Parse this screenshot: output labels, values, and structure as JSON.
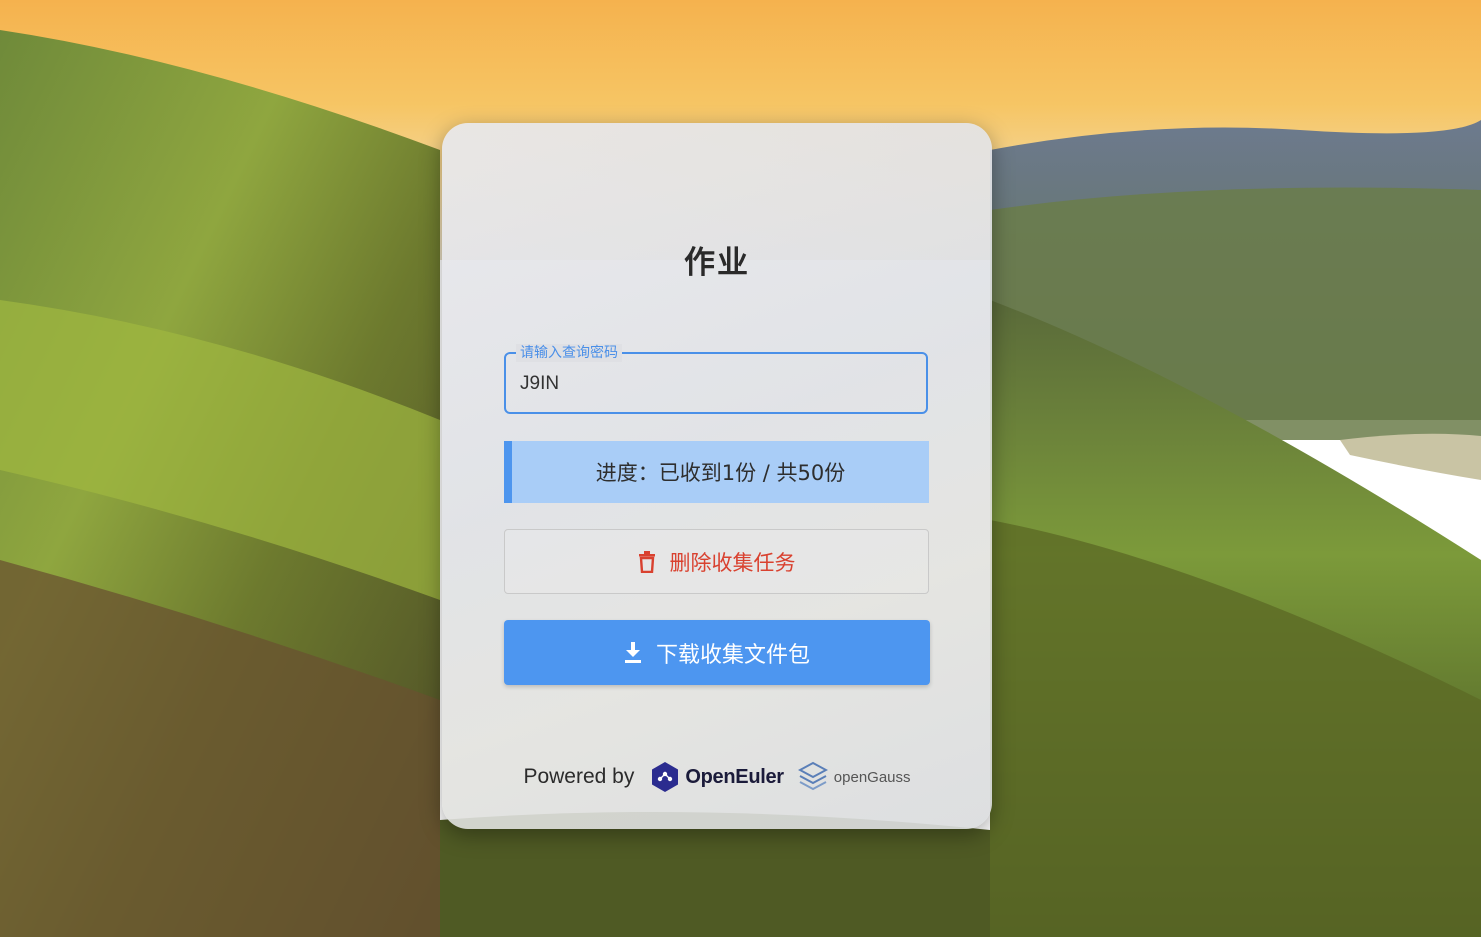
{
  "card": {
    "title": "作业"
  },
  "password_field": {
    "label": "请输入查询密码",
    "value": "J9IN"
  },
  "progress": {
    "text": "进度：已收到1份 / 共50份",
    "received": 1,
    "total": 50
  },
  "actions": {
    "delete_label": "删除收集任务",
    "delete_icon": "trash-icon",
    "download_label": "下载收集文件包",
    "download_icon": "download-icon"
  },
  "footer": {
    "powered_by": "Powered by",
    "logo1_text": "OpenEuler",
    "logo2_text": "openGauss"
  },
  "colors": {
    "accent": "#4d96f0",
    "danger": "#d9412f",
    "progress_bg": "#a9cdf7"
  }
}
